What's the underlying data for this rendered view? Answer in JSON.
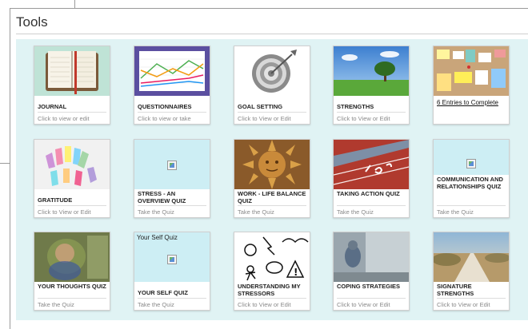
{
  "panel": {
    "title": "Tools"
  },
  "tiles": [
    {
      "label": "JOURNAL",
      "action": "Click to view or edit",
      "icon": "journal-book-image"
    },
    {
      "label": "QUESTIONNAIRES",
      "action": "Click to view or take",
      "icon": "line-chart-image"
    },
    {
      "label": "GOAL SETTING",
      "action": "Click to View or Edit",
      "icon": "target-arrow-image"
    },
    {
      "label": "STRENGTHS",
      "action": "Click to View or Edit",
      "icon": "tree-field-image"
    },
    {
      "label": "",
      "action": "6 Entries to Complete",
      "icon": "corkboard-image"
    },
    {
      "label": "GRATITUDE",
      "action": "Click to View or Edit",
      "icon": "sticky-tags-image"
    },
    {
      "label": "STRESS - AN OVERVIEW QUIZ",
      "action": "Take the Quiz",
      "icon": "broken-image"
    },
    {
      "label": "WORK - LIFE BALANCE QUIZ",
      "action": "Take the Quiz",
      "icon": "sun-face-image"
    },
    {
      "label": "TAKING ACTION QUIZ",
      "action": "Take the Quiz",
      "icon": "running-track-image"
    },
    {
      "label": "COMMUNICATION AND RELATIONSHIPS QUIZ",
      "action": "Take the Quiz",
      "icon": "broken-image"
    },
    {
      "label": "YOUR THOUGHTS QUIZ",
      "action": "Take the Quiz",
      "icon": "blurred-person-image"
    },
    {
      "label": "YOUR SELF QUIZ",
      "action": "Take the Quiz",
      "icon": "broken-image",
      "caption": "Your Self Quiz"
    },
    {
      "label": "UNDERSTANDING MY STRESSORS",
      "action": "Click to View or Edit",
      "icon": "stressors-icons-image"
    },
    {
      "label": "COPING STRATEGIES",
      "action": "Click to View or Edit",
      "icon": "window-figure-image"
    },
    {
      "label": "SIGNATURE STRENGTHS",
      "action": "Click to View or Edit",
      "icon": "road-path-image"
    }
  ]
}
